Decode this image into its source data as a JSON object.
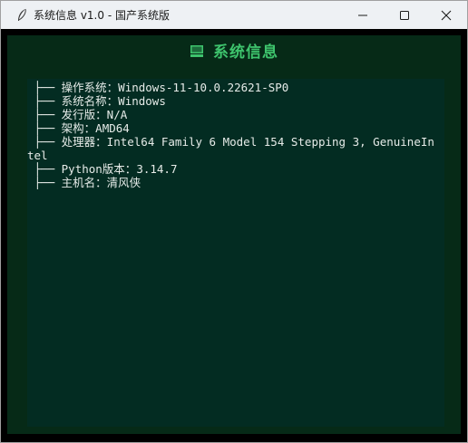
{
  "window": {
    "title": "系统信息 v1.0 - 国产系统版"
  },
  "header": {
    "title": "系统信息"
  },
  "info": {
    "prefix": " ├── ",
    "items": [
      {
        "label": "操作系统",
        "value": "Windows-11-10.0.22621-SP0"
      },
      {
        "label": "系统名称",
        "value": "Windows"
      },
      {
        "label": "发行版",
        "value": "N/A"
      },
      {
        "label": "架构",
        "value": "AMD64"
      },
      {
        "label": "处理器",
        "value": "Intel64 Family 6 Model 154 Stepping 3, GenuineIntel"
      },
      {
        "label": "Python版本",
        "value": "3.14.7"
      },
      {
        "label": "主机名",
        "value": "清风侠"
      }
    ],
    "separator": "："
  },
  "icons": {
    "app": "feather-icon",
    "header": "monitor-icon"
  },
  "colors": {
    "header_title": "#3ec46d",
    "frame_bg": "#062a17",
    "content_bg": "#032c22",
    "text": "#e6ebe8"
  }
}
